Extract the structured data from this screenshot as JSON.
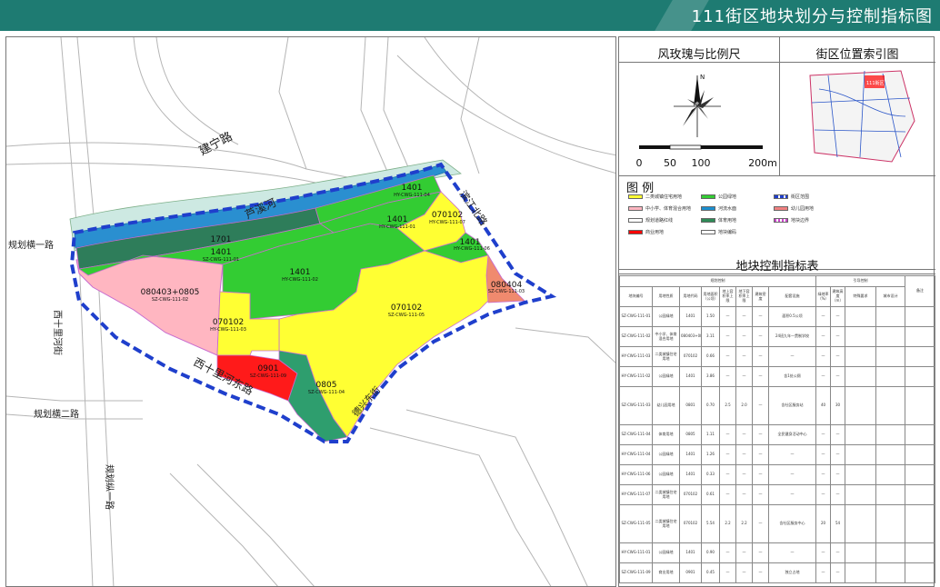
{
  "title": "111街区地块划分与控制指标图",
  "sections": {
    "compass_title": "风玫瑰与比例尺",
    "index_title": "街区位置索引图",
    "legend_title": "图  例",
    "table_title": "地块控制指标表"
  },
  "compass": {
    "north": "N"
  },
  "scale": {
    "labels": [
      "0",
      "50",
      "100",
      "200m"
    ]
  },
  "index_map": {
    "label": "111街区"
  },
  "legend": [
    {
      "label": "二类城镇住宅用地",
      "color": "#ffff33"
    },
    {
      "label": "公园绿地",
      "color": "#33cc33"
    },
    {
      "label": "街区范围",
      "color": "#1f3fcc"
    },
    {
      "label": "中小学、体育混合用地",
      "color": "#ffb6c1"
    },
    {
      "label": "河流水面",
      "color": "#1c8fcf"
    },
    {
      "label": "幼儿园用地",
      "color": "#f08080"
    },
    {
      "label": "规划道路红线",
      "color": "#ffffff"
    },
    {
      "label": "体育用地",
      "color": "#2e8b57"
    },
    {
      "label": "地块边界",
      "color": "#cc44cc"
    },
    {
      "label": "商业用地",
      "color": "#ff0000"
    },
    {
      "label": "地块编码",
      "color": "#ffffff"
    }
  ],
  "map": {
    "roads": {
      "jianning": "建宁路",
      "river": "芦溪河",
      "guihua_heng1": "规划横一路",
      "guihua_heng2": "规划横二路",
      "guihua_zong1": "规划纵一路",
      "xishili_he_jie": "西十里河街",
      "xishili_he_dongjie": "西十里河东路",
      "huanbei": "德兴东街",
      "binhe": "滨江北路"
    },
    "parcels": [
      {
        "code": "1401",
        "id": "HY-CWG-111-04"
      },
      {
        "code": "1401",
        "id": "HY-CWG-111-01"
      },
      {
        "code": "070102",
        "id": "HY-CWG-111-07"
      },
      {
        "code": "1401",
        "id": "HY-CWG-111-06"
      },
      {
        "code": "1701",
        "id": ""
      },
      {
        "code": "1401",
        "id": "SZ-CWG-111-01"
      },
      {
        "code": "1401",
        "id": "HY-CWG-111-02"
      },
      {
        "code": "080403+0805",
        "id": "SZ-CWG-111-02"
      },
      {
        "code": "080404",
        "id": "SZ-CWG-111-03"
      },
      {
        "code": "070102",
        "id": "SZ-CWG-111-05"
      },
      {
        "code": "070102",
        "id": "HY-CWG-111-03"
      },
      {
        "code": "0901",
        "id": "SZ-CWG-111-09"
      },
      {
        "code": "0805",
        "id": "SZ-CWG-111-04"
      }
    ]
  },
  "table": {
    "group_headers": [
      "规划控制",
      "引导控制",
      "备注"
    ],
    "headers": [
      "地块编号",
      "用地性质",
      "用地代码",
      "用地面积（公顷）",
      "地上容积率上限",
      "地下容积率上限",
      "建筑密度",
      "配套设施",
      "绿地率（%）",
      "建筑高度（m）",
      "特殊要求",
      "城市设计"
    ],
    "rows": [
      [
        "SZ-CWG-111-01",
        "公园绿地",
        "1401",
        "1.50",
        "—",
        "—",
        "—",
        "面积0.5公顷",
        "—",
        "—"
      ],
      [
        "SZ-CWG-111-02",
        "中小学、体育混合用地",
        "080403+0805",
        "3.11",
        "—",
        "—",
        "—",
        "24班九年一贯制学校",
        "—",
        "—"
      ],
      [
        "HY-CWG-111-03",
        "二类城镇住宅用地",
        "070102",
        "0.66",
        "—",
        "—",
        "—",
        "—",
        "—",
        "—"
      ],
      [
        "HY-CWG-111-02",
        "公园绿地",
        "1401",
        "3.86",
        "—",
        "—",
        "—",
        "含1处公厕",
        "—",
        "—"
      ],
      [
        "SZ-CWG-111-03",
        "幼儿园用地",
        "0801",
        "0.70",
        "2.5",
        "2.0",
        "—",
        "含社区服务站",
        "40",
        "30"
      ],
      [
        "SZ-CWG-111-04",
        "体育用地",
        "0805",
        "1.11",
        "—",
        "—",
        "—",
        "全民健身活动中心",
        "—",
        "—"
      ],
      [
        "HY-CWG-111-04",
        "公园绿地",
        "1401",
        "1.26",
        "—",
        "—",
        "—",
        "—",
        "—",
        "—"
      ],
      [
        "HY-CWG-111-06",
        "公园绿地",
        "1401",
        "0.33",
        "—",
        "—",
        "—",
        "—",
        "—",
        "—"
      ],
      [
        "HY-CWG-111-07",
        "二类城镇住宅用地",
        "070102",
        "0.61",
        "—",
        "—",
        "—",
        "—",
        "—",
        "—"
      ],
      [
        "SZ-CWG-111-05",
        "二类城镇住宅用地",
        "070102",
        "5.54",
        "2.2",
        "2.2",
        "—",
        "含社区服务中心",
        "20",
        "54"
      ],
      [
        "HY-CWG-111-01",
        "公园绿地",
        "1401",
        "0.90",
        "—",
        "—",
        "—",
        "—",
        "—",
        "—"
      ],
      [
        "SZ-CWG-111-09",
        "商业用地",
        "0901",
        "0.45",
        "—",
        "—",
        "—",
        "独立占地",
        "—",
        "—"
      ]
    ]
  }
}
